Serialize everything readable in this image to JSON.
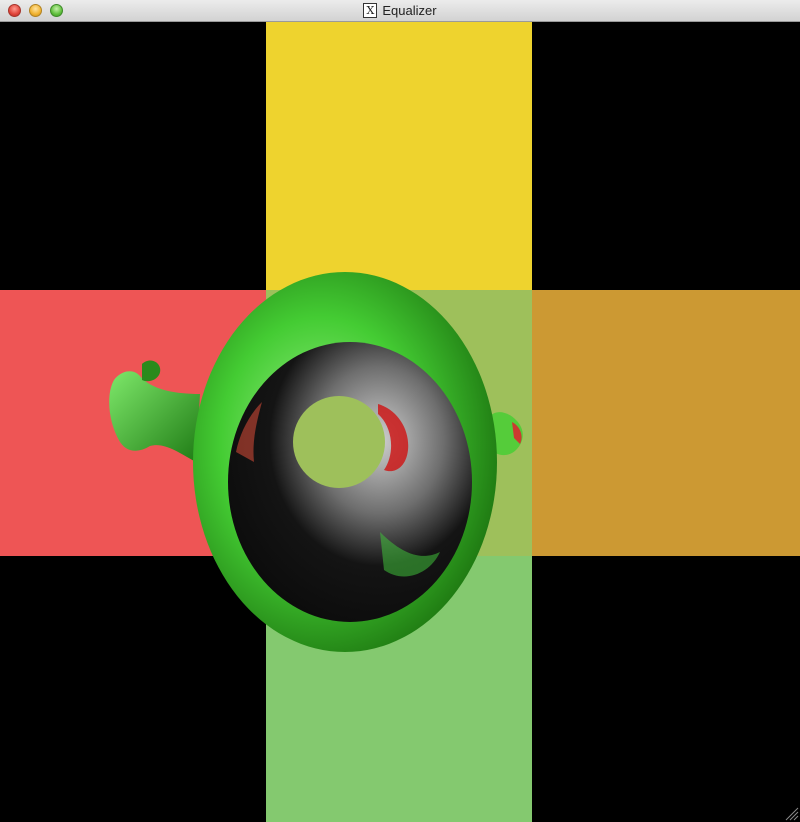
{
  "window": {
    "title": "Equalizer",
    "app_icon_glyph": "X",
    "app_icon": "x11-icon"
  },
  "viewport": {
    "background": "#000000",
    "tile_colors": {
      "top": "#eed32e",
      "left": "#ee5555",
      "center": "#9ec05b",
      "right": "#cc9933",
      "bottom": "#84c96f"
    },
    "model_color": "#44cc33",
    "model_inner": "#0e0e0e",
    "hole_color": "#9ec05b"
  }
}
